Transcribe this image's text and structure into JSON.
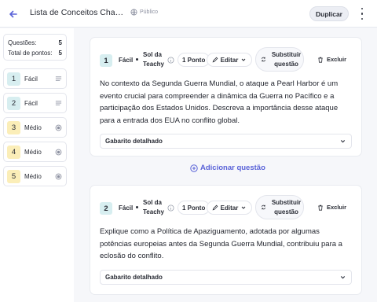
{
  "header": {
    "title": "Lista de Conceitos Chave d...",
    "visibility": "Público",
    "duplicate_label": "Duplicar"
  },
  "summary": {
    "questions_label": "Questões:",
    "questions_value": "5",
    "points_label": "Total de pontos:",
    "points_value": "5"
  },
  "sidebar": {
    "items": [
      {
        "number": "1",
        "label": "Fácil",
        "icon": "lines-icon"
      },
      {
        "number": "2",
        "label": "Fácil",
        "icon": "lines-icon"
      },
      {
        "number": "3",
        "label": "Médio",
        "icon": "radio-icon"
      },
      {
        "number": "4",
        "label": "Médio",
        "icon": "radio-icon"
      },
      {
        "number": "5",
        "label": "Médio",
        "icon": "radio-icon"
      }
    ]
  },
  "questions": [
    {
      "number": "1",
      "difficulty": "Fácil",
      "author": "Sol da Teachy",
      "points": "1 Ponto",
      "edit_label": "Editar",
      "replace_label": "Substituir questão",
      "delete_label": "Excluir",
      "text": "No contexto da Segunda Guerra Mundial, o ataque a Pearl Harbor é um evento crucial para compreender a dinâmica da Guerra no Pacífico e a participação dos Estados Unidos. Descreva a importância desse ataque para a entrada dos EUA no conflito global.",
      "answer_label": "Gabarito detalhado"
    },
    {
      "number": "2",
      "difficulty": "Fácil",
      "author": "Sol da Teachy",
      "points": "1 Ponto",
      "edit_label": "Editar",
      "replace_label": "Substituir questão",
      "delete_label": "Excluir",
      "text": "Explique como a Política de Apaziguamento, adotada por algumas potências europeias antes da Segunda Guerra Mundial, contribuiu para a eclosão do conflito.",
      "answer_label": "Gabarito detalhado"
    }
  ],
  "add_question_label": "Adicionar questão",
  "colors": {
    "accent": "#5a63d8",
    "easy": "#d7eef0",
    "medium": "#fbeeb8"
  }
}
